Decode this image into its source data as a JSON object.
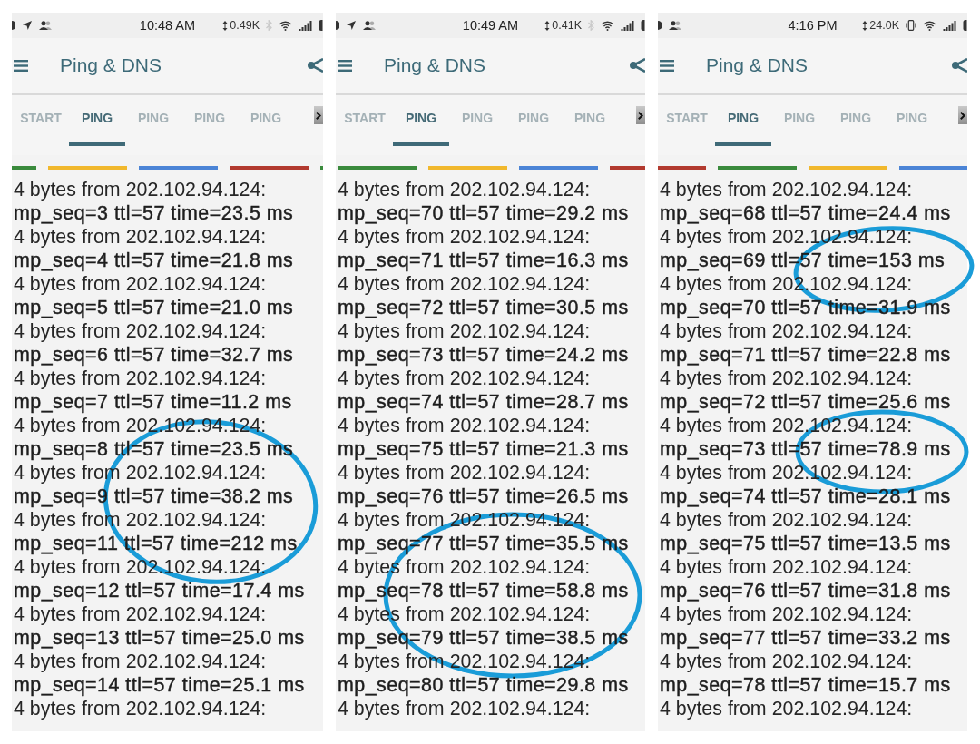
{
  "panels": [
    {
      "status_bar": {
        "time": "10:48 AM",
        "speed": "0.49K",
        "location_on": true,
        "bluetooth_on": true,
        "vibrate_on": false
      },
      "app_bar": {
        "title": "Ping & DNS"
      },
      "tabs": [
        {
          "label": "START",
          "selected": false
        },
        {
          "label": "PING",
          "selected": true
        },
        {
          "label": "PING",
          "selected": false
        },
        {
          "label": "PING",
          "selected": false
        },
        {
          "label": "PING",
          "selected": false
        }
      ],
      "color_bars": [
        {
          "color": "#3a8a3c"
        },
        {
          "color": "#f1b82d"
        },
        {
          "color": "#4b84d6"
        },
        {
          "color": "#b23a2f"
        },
        {
          "color": "#3a8a3c"
        }
      ],
      "log": [
        {
          "source": "4 bytes from 202.102.94.124:",
          "stats": "mp_seq=3 ttl=57 time=23.5 ms"
        },
        {
          "source": "4 bytes from 202.102.94.124:",
          "stats": "mp_seq=4 ttl=57 time=21.8 ms"
        },
        {
          "source": "4 bytes from 202.102.94.124:",
          "stats": "mp_seq=5 ttl=57 time=21.0 ms"
        },
        {
          "source": "4 bytes from 202.102.94.124:",
          "stats": "mp_seq=6 ttl=57 time=32.7 ms"
        },
        {
          "source": "4 bytes from 202.102.94.124:",
          "stats": "mp_seq=7 ttl=57 time=11.2 ms"
        },
        {
          "source": "4 bytes from 202.102.94.124:",
          "stats": "mp_seq=8 ttl=57 time=23.5 ms"
        },
        {
          "source": "4 bytes from 202.102.94.124:",
          "stats": "mp_seq=9 ttl=57 time=38.2 ms"
        },
        {
          "source": "4 bytes from 202.102.94.124:",
          "stats": "mp_seq=11 ttl=57 time=212 ms"
        },
        {
          "source": "4 bytes from 202.102.94.124:",
          "stats": "mp_seq=12 ttl=57 time=17.4 ms"
        },
        {
          "source": "4 bytes from 202.102.94.124:",
          "stats": "mp_seq=13 ttl=57 time=25.0 ms"
        },
        {
          "source": "4 bytes from 202.102.94.124:",
          "stats": "mp_seq=14 ttl=57 time=25.1 ms"
        },
        {
          "source": "4 bytes from 202.102.94.124:"
        }
      ]
    },
    {
      "status_bar": {
        "time": "10:49 AM",
        "speed": "0.41K",
        "location_on": true,
        "bluetooth_on": true,
        "vibrate_on": false
      },
      "app_bar": {
        "title": "Ping & DNS"
      },
      "tabs": [
        {
          "label": "START",
          "selected": false
        },
        {
          "label": "PING",
          "selected": true
        },
        {
          "label": "PING",
          "selected": false
        },
        {
          "label": "PING",
          "selected": false
        },
        {
          "label": "PING",
          "selected": false
        }
      ],
      "color_bars": [
        {
          "color": "#3a8a3c"
        },
        {
          "color": "#f1b82d"
        },
        {
          "color": "#4b84d6"
        },
        {
          "color": "#b23a2f"
        }
      ],
      "log": [
        {
          "source": "4 bytes from 202.102.94.124:",
          "stats": "mp_seq=70 ttl=57 time=29.2 ms"
        },
        {
          "source": "4 bytes from 202.102.94.124:",
          "stats": "mp_seq=71 ttl=57 time=16.3 ms"
        },
        {
          "source": "4 bytes from 202.102.94.124:",
          "stats": "mp_seq=72 ttl=57 time=30.5 ms"
        },
        {
          "source": "4 bytes from 202.102.94.124:",
          "stats": "mp_seq=73 ttl=57 time=24.2 ms"
        },
        {
          "source": "4 bytes from 202.102.94.124:",
          "stats": "mp_seq=74 ttl=57 time=28.7 ms"
        },
        {
          "source": "4 bytes from 202.102.94.124:",
          "stats": "mp_seq=75 ttl=57 time=21.3 ms"
        },
        {
          "source": "4 bytes from 202.102.94.124:",
          "stats": "mp_seq=76 ttl=57 time=26.5 ms"
        },
        {
          "source": "4 bytes from 202.102.94.124:",
          "stats": "mp_seq=77 ttl=57 time=35.5 ms"
        },
        {
          "source": "4 bytes from 202.102.94.124:",
          "stats": "mp_seq=78 ttl=57 time=58.8 ms"
        },
        {
          "source": "4 bytes from 202.102.94.124:",
          "stats": "mp_seq=79 ttl=57 time=38.5 ms"
        },
        {
          "source": "4 bytes from 202.102.94.124:",
          "stats": "mp_seq=80 ttl=57 time=29.8 ms"
        },
        {
          "source": "4 bytes from 202.102.94.124:"
        }
      ]
    },
    {
      "status_bar": {
        "time": "4:16 PM",
        "speed": "24.0K",
        "location_on": false,
        "bluetooth_on": false,
        "vibrate_on": true
      },
      "app_bar": {
        "title": "Ping & DNS"
      },
      "tabs": [
        {
          "label": "START",
          "selected": false
        },
        {
          "label": "PING",
          "selected": true
        },
        {
          "label": "PING",
          "selected": false
        },
        {
          "label": "PING",
          "selected": false
        },
        {
          "label": "PING",
          "selected": false
        }
      ],
      "color_bars": [
        {
          "color": "#b23a2f"
        },
        {
          "color": "#3a8a3c"
        },
        {
          "color": "#f1b82d"
        },
        {
          "color": "#4b84d6"
        }
      ],
      "log": [
        {
          "source": "4 bytes from 202.102.94.124:",
          "stats": "mp_seq=68 ttl=57 time=24.4 ms"
        },
        {
          "source": "4 bytes from 202.102.94.124:",
          "stats": "mp_seq=69 ttl=57 time=153 ms"
        },
        {
          "source": "4 bytes from 202.102.94.124:",
          "stats": "mp_seq=70 ttl=57 time=31.9 ms"
        },
        {
          "source": "4 bytes from 202.102.94.124:",
          "stats": "mp_seq=71 ttl=57 time=22.8 ms"
        },
        {
          "source": "4 bytes from 202.102.94.124:",
          "stats": "mp_seq=72 ttl=57 time=25.6 ms"
        },
        {
          "source": "4 bytes from 202.102.94.124:",
          "stats": "mp_seq=73 ttl=57 time=78.9 ms"
        },
        {
          "source": "4 bytes from 202.102.94.124:",
          "stats": "mp_seq=74 ttl=57 time=28.1 ms"
        },
        {
          "source": "4 bytes from 202.102.94.124:",
          "stats": "mp_seq=75 ttl=57 time=13.5 ms"
        },
        {
          "source": "4 bytes from 202.102.94.124:",
          "stats": "mp_seq=76 ttl=57 time=31.8 ms"
        },
        {
          "source": "4 bytes from 202.102.94.124:",
          "stats": "mp_seq=77 ttl=57 time=33.2 ms"
        },
        {
          "source": "4 bytes from 202.102.94.124:",
          "stats": "mp_seq=78 ttl=57 time=15.7 ms"
        },
        {
          "source": "4 bytes from 202.102.94.124:"
        }
      ]
    }
  ]
}
